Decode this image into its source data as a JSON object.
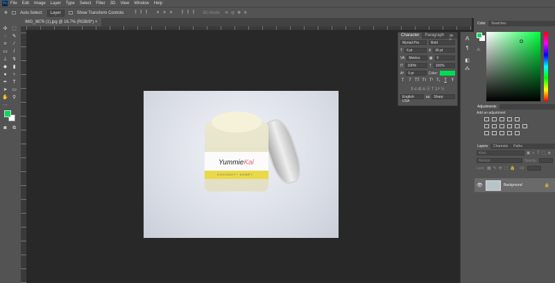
{
  "app": {
    "logo": "Ps"
  },
  "menu": [
    "File",
    "Edit",
    "Image",
    "Layer",
    "Type",
    "Select",
    "Filter",
    "3D",
    "View",
    "Window",
    "Help"
  ],
  "options": {
    "auto_select": "Auto-Select:",
    "layer_select": "Layer",
    "show_transform": "Show Transform Controls",
    "mode_3d": "3D Mode:"
  },
  "document": {
    "tab": "IMG_9876 (1).jpg @ 16.7% (RGB/8*)",
    "close": "×"
  },
  "photo": {
    "brand_a": "Yummie",
    "brand_b": "Kal",
    "product": "COCONUT+ HONEY"
  },
  "character": {
    "tabs": [
      "Character",
      "Paragraph"
    ],
    "font": "Myriad Pro",
    "style": "Bold",
    "size": "6 pt",
    "leading": "36 pt",
    "kerning": "Metrics",
    "tracking": "0",
    "vscale": "100%",
    "hscale": "100%",
    "baseline": "0 pt",
    "color_label": "Color:",
    "color": "#00dd55",
    "type_buttons": [
      "T",
      "T",
      "TT",
      "Tт",
      "T¹",
      "T₁",
      "T",
      "Ŧ"
    ],
    "language": "English: USA",
    "aa_label": "aa",
    "antialias": "Sharp"
  },
  "color_panel": {
    "tabs": [
      "Color",
      "Swatches"
    ],
    "foreground": "#00dd55",
    "background": "#ffffff"
  },
  "adjustments": {
    "title": "Adjustments",
    "subtitle": "Add an adjustment"
  },
  "layers": {
    "tabs": [
      "Layers",
      "Channels",
      "Paths"
    ],
    "kind": "Kind",
    "blend": "Normal",
    "opacity_label": "Opacity:",
    "lock_label": "Lock:",
    "fill_label": "Fill:",
    "items": [
      {
        "name": "Background",
        "visible": true,
        "locked": true
      }
    ]
  }
}
